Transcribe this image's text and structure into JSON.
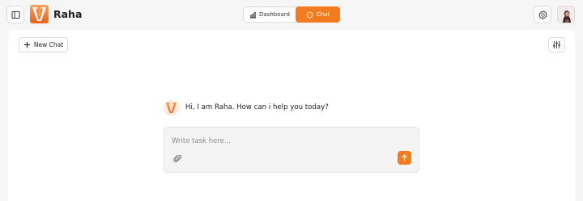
{
  "header": {
    "brand_name": "Raha",
    "tabs": [
      {
        "label": "Dashboard",
        "icon": "bar-chart-icon",
        "active": false
      },
      {
        "label": "Chat",
        "icon": "chat-icon",
        "active": true
      }
    ],
    "icons": {
      "sidebar_toggle": "sidebar-toggle-icon",
      "settings": "gear-icon",
      "avatar": "user-avatar"
    }
  },
  "chat": {
    "new_chat_label": "New Chat",
    "greeting": "Hi, I am Raha. How can i help you today?",
    "composer": {
      "placeholder": "Write task here...",
      "value": ""
    },
    "filter_icon": "sliders-icon",
    "attach_icon": "paperclip-icon",
    "send_icon": "arrow-up-icon"
  },
  "colors": {
    "accent": "#f47b20",
    "background": "#f6f6f6",
    "panel": "#ffffff",
    "composer_bg": "#f4f4f5",
    "border": "#dcdcdc"
  }
}
